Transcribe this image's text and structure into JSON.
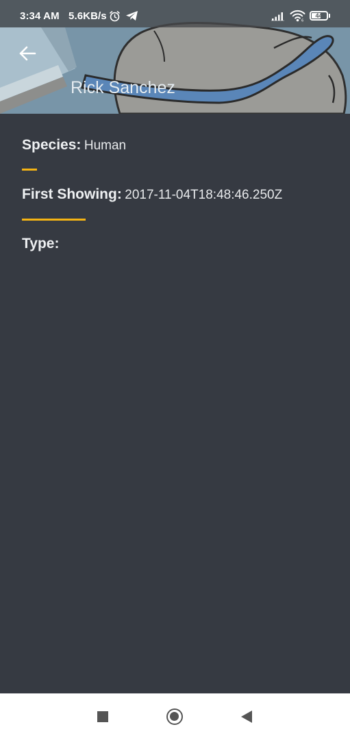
{
  "status_bar": {
    "time": "3:34 AM",
    "network_speed": "5.6KB/s",
    "battery_level": "44",
    "icons": [
      "alarm-icon",
      "telegram-icon",
      "signal-icon",
      "wifi-icon",
      "battery-icon"
    ]
  },
  "app_bar": {
    "title": "Rick Sanchez",
    "back_icon": "arrow-left-icon"
  },
  "details": {
    "species_label": "Species:",
    "species_value": "Human",
    "first_showing_label": "First Showing:",
    "first_showing_value": "2017-11-04T18:48:46.250Z",
    "type_label": "Type:",
    "type_value": ""
  },
  "nav_bar": {
    "icons": [
      "recents-square-icon",
      "home-circle-icon",
      "back-triangle-icon"
    ]
  },
  "colors": {
    "background": "#363a42",
    "accent": "#f5b414",
    "header_sky": "#7a97aa",
    "nav_bar": "#ffffff"
  }
}
